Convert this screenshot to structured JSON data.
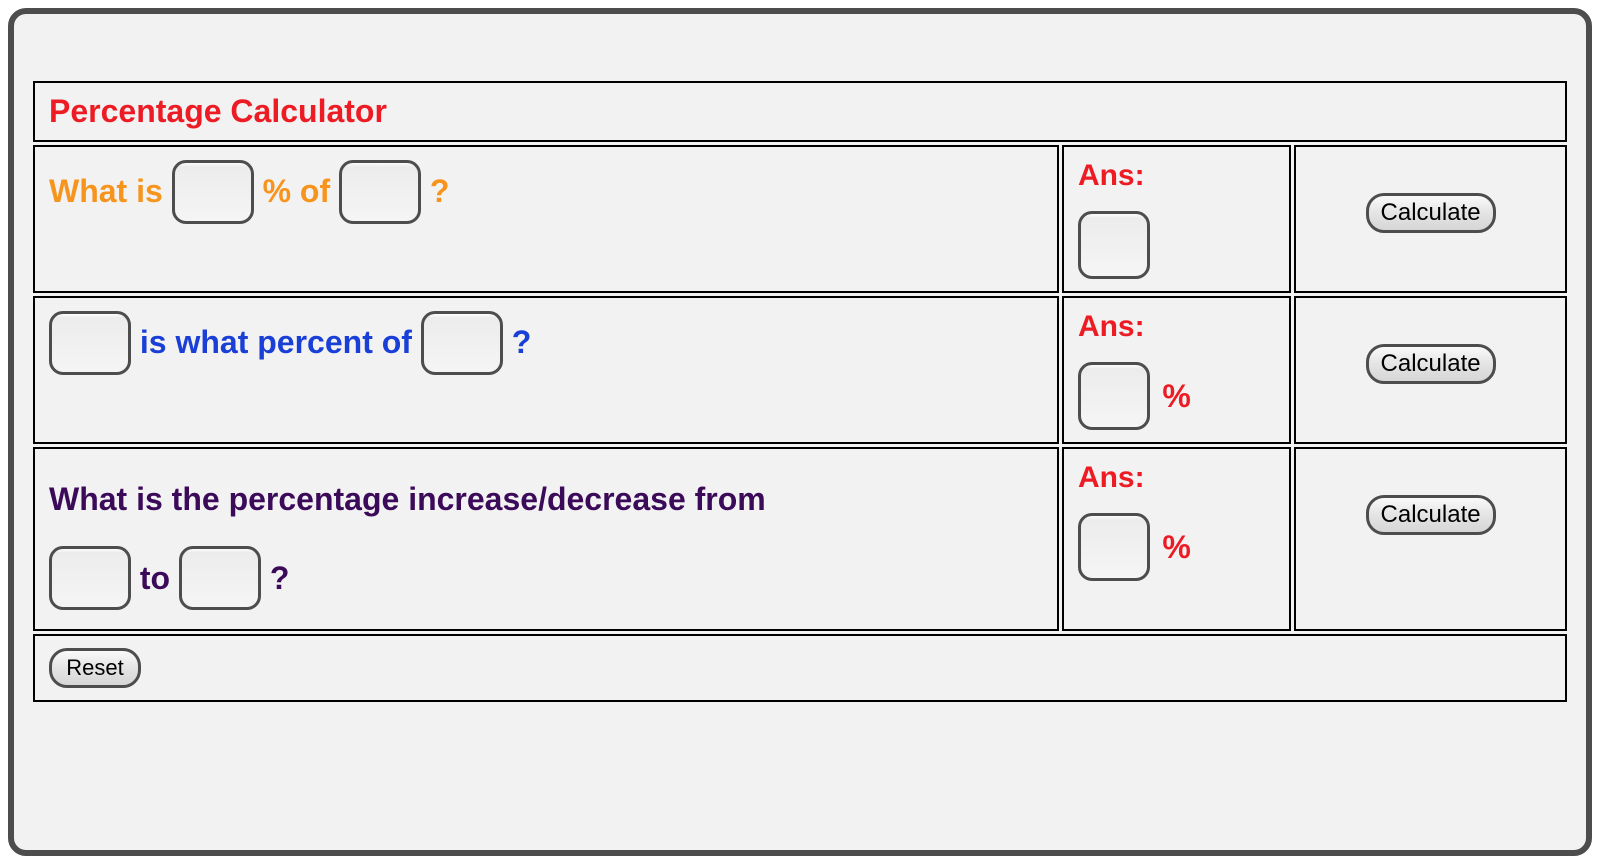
{
  "title": "Percentage Calculator",
  "rows": [
    {
      "segments": {
        "prefix": "What is ",
        "mid": " % of ",
        "suffix": "?"
      },
      "ans_label": "Ans:",
      "ans_suffix": "",
      "button": "Calculate"
    },
    {
      "segments": {
        "prefix": "",
        "mid": " is what percent of ",
        "suffix": "?"
      },
      "ans_label": "Ans:",
      "ans_suffix": "%",
      "button": "Calculate"
    },
    {
      "segments": {
        "line1": "What is the percentage increase/decrease from ",
        "mid": " to ",
        "suffix": "?"
      },
      "ans_label": "Ans:",
      "ans_suffix": "%",
      "button": "Calculate"
    }
  ],
  "footer": {
    "reset": "Reset"
  }
}
